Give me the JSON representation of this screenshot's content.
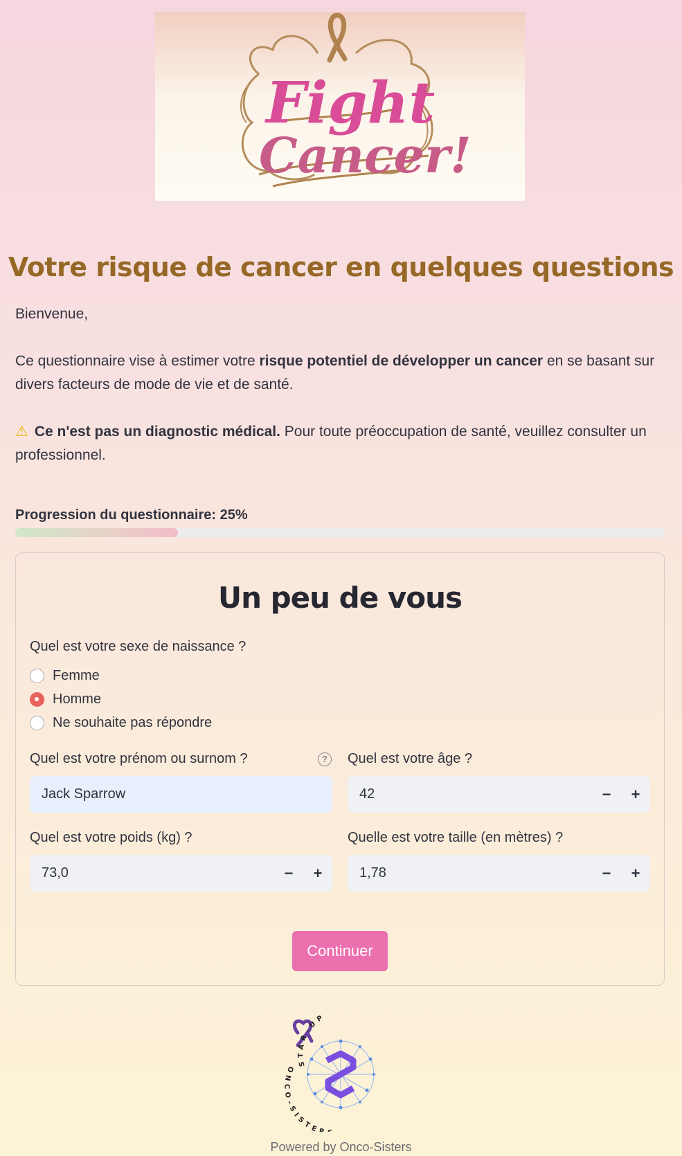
{
  "banner": {
    "logo_line1": "Fight",
    "logo_line2": "Cancer!"
  },
  "page_title": "Votre risque de cancer en quelques questions",
  "intro": {
    "greeting": "Bienvenue,",
    "text_before_bold": "Ce questionnaire vise à estimer votre ",
    "text_bold": "risque potentiel de développer un cancer",
    "text_after_bold": " en se basant sur divers facteurs de mode de vie et de santé.",
    "warning_icon": "warning-icon",
    "warning_bold": "Ce n'est pas un diagnostic médical.",
    "warning_text": " Pour toute préoccupation de santé, veuillez consulter un professionnel."
  },
  "progress": {
    "label": "Progression du questionnaire: 25%",
    "value": 0.25
  },
  "form": {
    "section_title": "Un peu de vous",
    "sex": {
      "question": "Quel est votre sexe de naissance ?",
      "options": [
        "Femme",
        "Homme",
        "Ne souhaite pas répondre"
      ],
      "selected": "Homme"
    },
    "name": {
      "question": "Quel est votre prénom ou surnom ?",
      "value": "Jack Sparrow",
      "help_icon": "help-icon"
    },
    "age": {
      "question": "Quel est votre âge ?",
      "value": "42",
      "minus": "−",
      "plus": "+"
    },
    "weight": {
      "question": "Quel est votre poids (kg) ?",
      "value": "73,0",
      "minus": "−",
      "plus": "+"
    },
    "height": {
      "question": "Quelle est votre taille (en mètres) ?",
      "value": "1,78",
      "minus": "−",
      "plus": "+"
    },
    "continue_label": "Continuer"
  },
  "footer": {
    "logo_top_text": "STAR-UP",
    "logo_bottom_text": "ONCO-SISTERS",
    "powered_by": "Powered by Onco-Sisters"
  },
  "colors": {
    "title": "#956826",
    "accent": "#ec6fae",
    "radio_selected": "#e8625c"
  }
}
